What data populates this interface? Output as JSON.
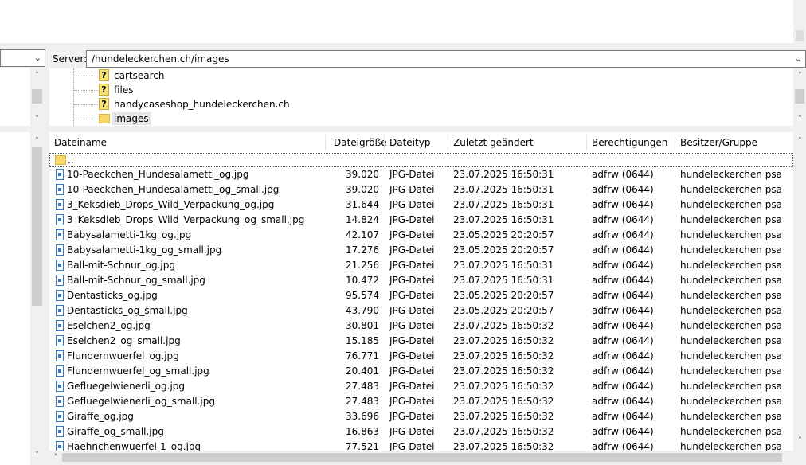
{
  "server_label": "Server:",
  "server_path": "/hundeleckerchen.ch/images",
  "tree": [
    {
      "name": "cartsearch",
      "icon": "question-folder-icon"
    },
    {
      "name": "files",
      "icon": "question-folder-icon"
    },
    {
      "name": "handycaseshop_hundeleckerchen.ch",
      "icon": "question-folder-icon"
    },
    {
      "name": "images",
      "icon": "folder-icon"
    }
  ],
  "columns": {
    "name": "Dateiname",
    "size": "Dateigröße",
    "type": "Dateityp",
    "modified": "Zuletzt geändert",
    "perms": "Berechtigungen",
    "owner": "Besitzer/Gruppe"
  },
  "parent_dir": "..",
  "files": [
    {
      "name": "10-Paeckchen_Hundesalametti_og.jpg",
      "size": "39.020",
      "type": "JPG-Datei",
      "modified": "23.07.2025 16:50:31",
      "perms": "adfrw (0644)",
      "owner": "hundeleckerchen psacln"
    },
    {
      "name": "10-Paeckchen_Hundesalametti_og_small.jpg",
      "size": "39.020",
      "type": "JPG-Datei",
      "modified": "23.07.2025 16:50:31",
      "perms": "adfrw (0644)",
      "owner": "hundeleckerchen psacln"
    },
    {
      "name": "3_Keksdieb_Drops_Wild_Verpackung_og.jpg",
      "size": "31.644",
      "type": "JPG-Datei",
      "modified": "23.07.2025 16:50:31",
      "perms": "adfrw (0644)",
      "owner": "hundeleckerchen psacln"
    },
    {
      "name": "3_Keksdieb_Drops_Wild_Verpackung_og_small.jpg",
      "size": "14.824",
      "type": "JPG-Datei",
      "modified": "23.07.2025 16:50:31",
      "perms": "adfrw (0644)",
      "owner": "hundeleckerchen psacln"
    },
    {
      "name": "Babysalametti-1kg_og.jpg",
      "size": "42.107",
      "type": "JPG-Datei",
      "modified": "23.05.2025 20:20:57",
      "perms": "adfrw (0644)",
      "owner": "hundeleckerchen psacln"
    },
    {
      "name": "Babysalametti-1kg_og_small.jpg",
      "size": "17.276",
      "type": "JPG-Datei",
      "modified": "23.05.2025 20:20:57",
      "perms": "adfrw (0644)",
      "owner": "hundeleckerchen psacln"
    },
    {
      "name": "Ball-mit-Schnur_og.jpg",
      "size": "21.256",
      "type": "JPG-Datei",
      "modified": "23.07.2025 16:50:31",
      "perms": "adfrw (0644)",
      "owner": "hundeleckerchen psacln"
    },
    {
      "name": "Ball-mit-Schnur_og_small.jpg",
      "size": "10.472",
      "type": "JPG-Datei",
      "modified": "23.07.2025 16:50:31",
      "perms": "adfrw (0644)",
      "owner": "hundeleckerchen psacln"
    },
    {
      "name": "Dentasticks_og.jpg",
      "size": "95.574",
      "type": "JPG-Datei",
      "modified": "23.05.2025 20:20:57",
      "perms": "adfrw (0644)",
      "owner": "hundeleckerchen psacln"
    },
    {
      "name": "Dentasticks_og_small.jpg",
      "size": "43.790",
      "type": "JPG-Datei",
      "modified": "23.05.2025 20:20:57",
      "perms": "adfrw (0644)",
      "owner": "hundeleckerchen psacln"
    },
    {
      "name": "Eselchen2_og.jpg",
      "size": "30.801",
      "type": "JPG-Datei",
      "modified": "23.07.2025 16:50:32",
      "perms": "adfrw (0644)",
      "owner": "hundeleckerchen psacln"
    },
    {
      "name": "Eselchen2_og_small.jpg",
      "size": "15.185",
      "type": "JPG-Datei",
      "modified": "23.07.2025 16:50:32",
      "perms": "adfrw (0644)",
      "owner": "hundeleckerchen psacln"
    },
    {
      "name": "Flundernwuerfel_og.jpg",
      "size": "76.771",
      "type": "JPG-Datei",
      "modified": "23.07.2025 16:50:32",
      "perms": "adfrw (0644)",
      "owner": "hundeleckerchen psacln"
    },
    {
      "name": "Flundernwuerfel_og_small.jpg",
      "size": "20.401",
      "type": "JPG-Datei",
      "modified": "23.07.2025 16:50:32",
      "perms": "adfrw (0644)",
      "owner": "hundeleckerchen psacln"
    },
    {
      "name": "Gefluegelwienerli_og.jpg",
      "size": "27.483",
      "type": "JPG-Datei",
      "modified": "23.07.2025 16:50:32",
      "perms": "adfrw (0644)",
      "owner": "hundeleckerchen psacln"
    },
    {
      "name": "Gefluegelwienerli_og_small.jpg",
      "size": "27.483",
      "type": "JPG-Datei",
      "modified": "23.07.2025 16:50:32",
      "perms": "adfrw (0644)",
      "owner": "hundeleckerchen psacln"
    },
    {
      "name": "Giraffe_og.jpg",
      "size": "33.696",
      "type": "JPG-Datei",
      "modified": "23.07.2025 16:50:32",
      "perms": "adfrw (0644)",
      "owner": "hundeleckerchen psacln"
    },
    {
      "name": "Giraffe_og_small.jpg",
      "size": "16.863",
      "type": "JPG-Datei",
      "modified": "23.07.2025 16:50:32",
      "perms": "adfrw (0644)",
      "owner": "hundeleckerchen psacln"
    },
    {
      "name": "Haehnchenwuerfel-1_og.jpg",
      "size": "77.521",
      "type": "JPG-Datei",
      "modified": "23.07.2025 16:50:32",
      "perms": "adfrw (0644)",
      "owner": "hundeleckerchen psacln"
    }
  ]
}
